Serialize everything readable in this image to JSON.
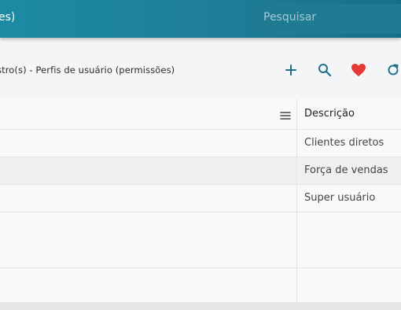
{
  "header": {
    "title": "es)",
    "search_placeholder": "Pesquisar"
  },
  "toolbar": {
    "breadcrumb": "stro(s) - Perfis de usuário (permissões)",
    "icons": [
      "add-icon",
      "search-icon",
      "heart-icon",
      "refresh-icon"
    ],
    "heart_color": "#e53935",
    "icon_color": "#1f6f86"
  },
  "grid": {
    "column_header": "Descrição",
    "rows": [
      {
        "descricao": "Clientes diretos"
      },
      {
        "descricao": "Força de vendas"
      },
      {
        "descricao": "Super usuário"
      }
    ]
  }
}
